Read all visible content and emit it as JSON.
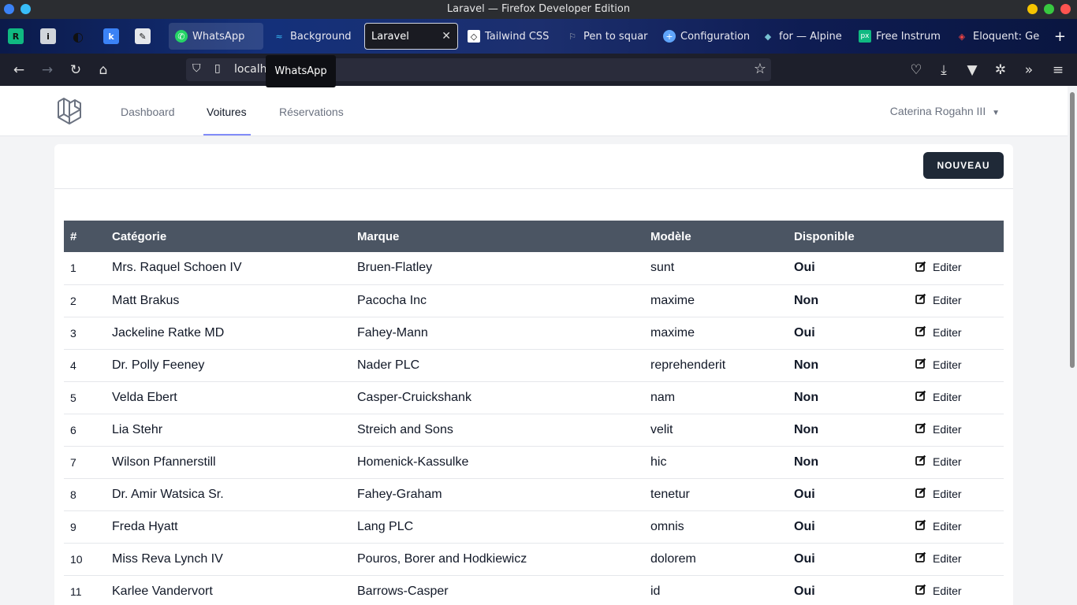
{
  "window": {
    "title": "Laravel — Firefox Developer Edition"
  },
  "tabs": [
    {
      "label": "WhatsApp",
      "icon": "whatsapp-icon"
    },
    {
      "label": "Background",
      "icon": "tailwind-icon"
    },
    {
      "label": "Laravel",
      "icon": "none",
      "active": true
    },
    {
      "label": "Tailwind CSS",
      "icon": "codepen-icon"
    },
    {
      "label": "Pen to squar",
      "icon": "flag-icon"
    },
    {
      "label": "Configuration",
      "icon": "plus-circle-icon"
    },
    {
      "label": "for — Alpine",
      "icon": "alpine-icon"
    },
    {
      "label": "Free Instrum",
      "icon": "px-icon"
    },
    {
      "label": "Eloquent: Ge",
      "icon": "laravel-icon"
    }
  ],
  "urlbar": {
    "text": "localh",
    "tooltip": "WhatsApp"
  },
  "app": {
    "nav": {
      "dashboard": "Dashboard",
      "voitures": "Voitures",
      "reservations": "Réservations"
    },
    "user": "Caterina Rogahn III",
    "new_button": "NOUVEAU"
  },
  "table": {
    "headers": [
      "#",
      "Catégorie",
      "Marque",
      "Modèle",
      "Disponible",
      ""
    ],
    "edit_label": "Editer",
    "rows": [
      {
        "id": "1",
        "categorie": "Mrs. Raquel Schoen IV",
        "marque": "Bruen-Flatley",
        "modele": "sunt",
        "dispo": "Oui"
      },
      {
        "id": "2",
        "categorie": "Matt Brakus",
        "marque": "Pacocha Inc",
        "modele": "maxime",
        "dispo": "Non"
      },
      {
        "id": "3",
        "categorie": "Jackeline Ratke MD",
        "marque": "Fahey-Mann",
        "modele": "maxime",
        "dispo": "Oui"
      },
      {
        "id": "4",
        "categorie": "Dr. Polly Feeney",
        "marque": "Nader PLC",
        "modele": "reprehenderit",
        "dispo": "Non"
      },
      {
        "id": "5",
        "categorie": "Velda Ebert",
        "marque": "Casper-Cruickshank",
        "modele": "nam",
        "dispo": "Non"
      },
      {
        "id": "6",
        "categorie": "Lia Stehr",
        "marque": "Streich and Sons",
        "modele": "velit",
        "dispo": "Non"
      },
      {
        "id": "7",
        "categorie": "Wilson Pfannerstill",
        "marque": "Homenick-Kassulke",
        "modele": "hic",
        "dispo": "Non"
      },
      {
        "id": "8",
        "categorie": "Dr. Amir Watsica Sr.",
        "marque": "Fahey-Graham",
        "modele": "tenetur",
        "dispo": "Oui"
      },
      {
        "id": "9",
        "categorie": "Freda Hyatt",
        "marque": "Lang PLC",
        "modele": "omnis",
        "dispo": "Oui"
      },
      {
        "id": "10",
        "categorie": "Miss Reva Lynch IV",
        "marque": "Pouros, Borer and Hodkiewicz",
        "modele": "dolorem",
        "dispo": "Oui"
      },
      {
        "id": "11",
        "categorie": "Karlee Vandervort",
        "marque": "Barrows-Casper",
        "modele": "id",
        "dispo": "Oui"
      }
    ]
  }
}
